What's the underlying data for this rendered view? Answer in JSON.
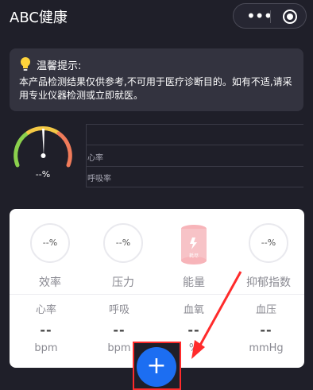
{
  "app": {
    "title": "ABC健康"
  },
  "capsule": {
    "more_label": "•••"
  },
  "notice": {
    "title": "温馨提示:",
    "body": "本产品检测结果仅供参考,不可用于医疗诊断目的。如有不适,请采用专业仪器检测或立即就医。"
  },
  "gauge": {
    "value": "--%"
  },
  "metrics": {
    "labels": [
      "心率",
      "呼吸率"
    ]
  },
  "card": {
    "top_items": [
      {
        "value": "--%",
        "label": "效率"
      },
      {
        "value": "--%",
        "label": "压力"
      },
      {
        "value": "",
        "label": "能量",
        "icon_text": "耗尽"
      },
      {
        "value": "--%",
        "label": "抑郁指数"
      }
    ],
    "vitals": [
      {
        "name": "心率",
        "value": "--",
        "unit": "bpm"
      },
      {
        "name": "呼吸",
        "value": "--",
        "unit": "bpm"
      },
      {
        "name": "血氧",
        "value": "--",
        "unit": "%"
      },
      {
        "name": "血压",
        "value": "--",
        "unit": "mmHg"
      }
    ]
  },
  "fab": {
    "label": "+"
  },
  "colors": {
    "background": "#1f1f29",
    "accent": "#1c6ef2",
    "highlight": "#ff2b2b",
    "energy_icon": "#f7b4b9"
  }
}
